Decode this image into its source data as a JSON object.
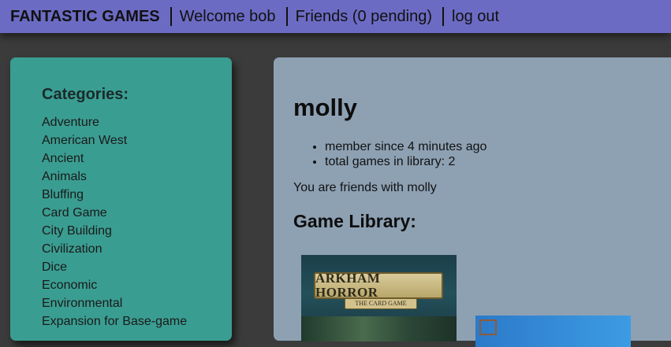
{
  "nav": {
    "brand": "FANTASTIC GAMES",
    "welcome": "Welcome bob",
    "friends": "Friends (0 pending)",
    "logout": "log out"
  },
  "sidebar": {
    "heading": "Categories:",
    "categories": [
      "Adventure",
      "American West",
      "Ancient",
      "Animals",
      "Bluffing",
      "Card Game",
      "City Building",
      "Civilization",
      "Dice",
      "Economic",
      "Environmental",
      "Expansion for Base-game"
    ]
  },
  "profile": {
    "username": "molly",
    "stats": [
      "member since 4 minutes ago",
      "total games in library: 2"
    ],
    "friend_status": "You are friends with molly",
    "library_title": "Game Library:",
    "games": [
      {
        "title": "ARKHAM HORROR",
        "subtitle": "THE CARD GAME"
      }
    ]
  },
  "colors": {
    "topbar": "#6c6bc4",
    "sidebar": "#3a9d91",
    "main_panel": "#8ea1b3",
    "page_background": "#3b3b3b"
  }
}
